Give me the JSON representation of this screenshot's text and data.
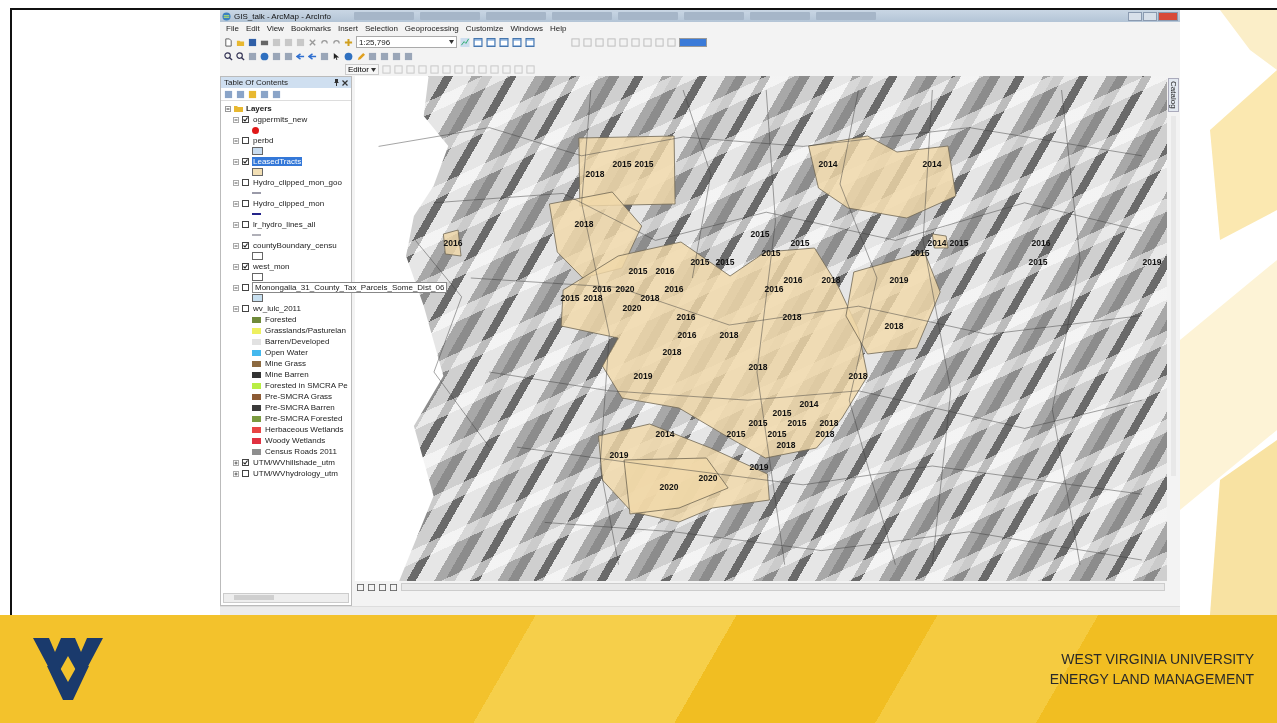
{
  "window": {
    "title": "GIS_talk - ArcMap - ArcInfo",
    "menu": [
      "File",
      "Edit",
      "View",
      "Bookmarks",
      "Insert",
      "Selection",
      "Geoprocessing",
      "Customize",
      "Windows",
      "Help"
    ],
    "scale_field": {
      "value": "1:25,796"
    },
    "editor_menu": "Editor",
    "toc": {
      "title": "Table Of Contents",
      "root": {
        "label": "Layers",
        "expanded": true
      },
      "layers": [
        {
          "name": "ogpermits_new",
          "checked": true,
          "expanded": true,
          "selected": false,
          "renaming": false,
          "symbol": {
            "kind": "point",
            "color": "#e01818"
          }
        },
        {
          "name": "perbd",
          "checked": false,
          "expanded": true,
          "selected": false,
          "renaming": false,
          "symbol": {
            "kind": "fill",
            "color": "#c8dcf0"
          }
        },
        {
          "name": "LeasedTracts",
          "checked": true,
          "expanded": true,
          "selected": true,
          "renaming": false,
          "symbol": {
            "kind": "fill",
            "color": "#f2dfb4"
          }
        },
        {
          "name": "Hydro_clipped_mon_goo",
          "checked": false,
          "expanded": true,
          "selected": false,
          "renaming": false,
          "symbol": {
            "kind": "line",
            "color": "#9a9aa8"
          }
        },
        {
          "name": "Hydro_clipped_mon",
          "checked": false,
          "expanded": true,
          "selected": false,
          "renaming": false,
          "symbol": {
            "kind": "line",
            "color": "#24248a"
          }
        },
        {
          "name": "lr_hydro_lines_all",
          "checked": false,
          "expanded": true,
          "selected": false,
          "renaming": false,
          "symbol": {
            "kind": "line",
            "color": "#b0b0b8"
          }
        },
        {
          "name": "countyBoundary_censu",
          "checked": true,
          "expanded": true,
          "selected": false,
          "renaming": false,
          "symbol": {
            "kind": "fill",
            "color": "#ffffff"
          }
        },
        {
          "name": "west_mon",
          "checked": true,
          "expanded": true,
          "selected": false,
          "renaming": false,
          "symbol": {
            "kind": "fill",
            "color": "#ffffff"
          }
        },
        {
          "name": "Monongalia_31_County_Tax_Parcels_Some_Dist_06",
          "checked": false,
          "expanded": true,
          "selected": false,
          "renaming": true,
          "symbol": {
            "kind": "fill",
            "color": "#c8e0f0"
          }
        },
        {
          "name": "wv_lulc_2011",
          "checked": false,
          "expanded": true,
          "selected": false,
          "renaming": false,
          "legend": [
            {
              "label": "Forested",
              "color": "#6f8a3a"
            },
            {
              "label": "Grasslands/Pasturelan",
              "color": "#eef060"
            },
            {
              "label": "Barren/Developed",
              "color": "#e2e2e2"
            },
            {
              "label": "Open Water",
              "color": "#44b8ee"
            },
            {
              "label": "Mine Grass",
              "color": "#8c6a40"
            },
            {
              "label": "Mine Barren",
              "color": "#333333"
            },
            {
              "label": "Forested in SMCRA Pe",
              "color": "#b8ee44"
            },
            {
              "label": "Pre-SMCRA Grass",
              "color": "#8c5a34"
            },
            {
              "label": "Pre-SMCRA Barren",
              "color": "#3a3a3a"
            },
            {
              "label": "Pre-SMCRA Forested",
              "color": "#7a9a40"
            },
            {
              "label": "Herbaceous Wetlands",
              "color": "#e84444"
            },
            {
              "label": "Woody Wetlands",
              "color": "#e03040"
            },
            {
              "label": "Census Roads 2011",
              "color": "#8e8e8e"
            }
          ]
        },
        {
          "name": "UTM/WVhillshade_utm",
          "checked": true,
          "expanded": false,
          "selected": false,
          "renaming": false
        },
        {
          "name": "UTM/WVhydrology_utm",
          "checked": false,
          "expanded": false,
          "selected": false,
          "renaming": false
        }
      ]
    },
    "map": {
      "labels": [
        "2015",
        "2015",
        "2014",
        "2014",
        "2018",
        "2018",
        "2015",
        "2016",
        "2015",
        "2014",
        "2015",
        "2016",
        "2015",
        "2015",
        "2015",
        "2015",
        "2015",
        "2019",
        "2015",
        "2016",
        "2016",
        "2018",
        "2019",
        "2016",
        "2020",
        "2016",
        "2016",
        "2015",
        "2018",
        "2018",
        "2020",
        "2016",
        "2018",
        "2018",
        "2016",
        "2018",
        "2018",
        "2018",
        "2019",
        "2018",
        "2014",
        "2015",
        "2015",
        "2015",
        "2018",
        "2014",
        "2015",
        "2015",
        "2018",
        "2018",
        "2019",
        "2019",
        "2020",
        "2020"
      ]
    },
    "side_tab": "Catalog"
  },
  "footer": {
    "lines": [
      "WEST VIRGINIA UNIVERSITY",
      "ENERGY LAND MANAGEMENT"
    ]
  }
}
